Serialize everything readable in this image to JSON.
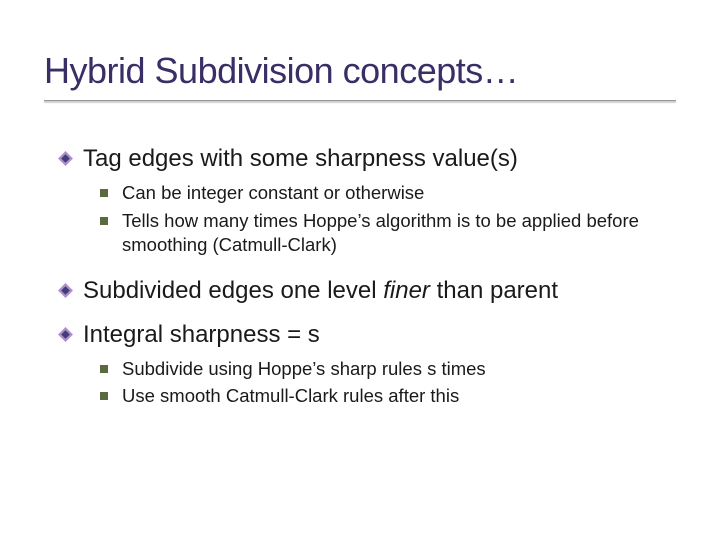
{
  "title": "Hybrid Subdivision concepts…",
  "bullets": [
    {
      "text": "Tag edges with some sharpness value(s)",
      "sub": [
        "Can be integer constant or otherwise",
        "Tells how many times Hoppe’s algorithm is to be applied before smoothing (Catmull-Clark)"
      ]
    },
    {
      "text_pre": "Subdivided edges one level ",
      "text_em": "finer",
      "text_post": " than parent",
      "sub": []
    },
    {
      "text": "Integral sharpness = s",
      "sub": [
        "Subdivide using Hoppe’s sharp rules s times",
        "Use smooth Catmull-Clark rules after this"
      ]
    }
  ],
  "colors": {
    "title": "#3a2e66",
    "bullet_outer": "#b08fc9",
    "bullet_inner": "#3f3f78",
    "sub_bullet": "#5a6a3f"
  }
}
